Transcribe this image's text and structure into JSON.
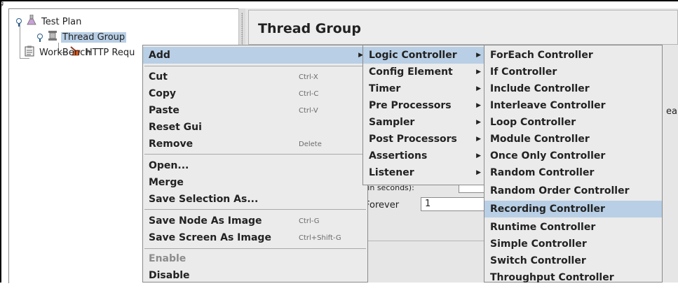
{
  "window": {
    "corner_mark": "g"
  },
  "tree": {
    "items": [
      {
        "label": "Test Plan",
        "icon": "flask-icon"
      },
      {
        "label": "Thread Group",
        "icon": "spool-icon"
      },
      {
        "label": "HTTP Requ",
        "icon": "broom-icon"
      },
      {
        "label": "WorkBench",
        "icon": "clipboard-icon"
      }
    ]
  },
  "panel": {
    "title": "Thread Group",
    "fragment_right": "ea",
    "seconds_fragment": "(in seconds):",
    "delay_value": "1",
    "loop_label": "Forever",
    "loop_value": "1"
  },
  "context_menu": {
    "items": [
      {
        "label": "Add",
        "shortcut": "",
        "submenu": true
      },
      {
        "label": "Cut",
        "shortcut": "Ctrl-X"
      },
      {
        "label": "Copy",
        "shortcut": "Ctrl-C"
      },
      {
        "label": "Paste",
        "shortcut": "Ctrl-V"
      },
      {
        "label": "Reset Gui",
        "shortcut": ""
      },
      {
        "label": "Remove",
        "shortcut": "Delete"
      },
      {
        "label": "Open...",
        "shortcut": ""
      },
      {
        "label": "Merge",
        "shortcut": ""
      },
      {
        "label": "Save Selection As...",
        "shortcut": ""
      },
      {
        "label": "Save Node As Image",
        "shortcut": "Ctrl-G"
      },
      {
        "label": "Save Screen As Image",
        "shortcut": "Ctrl+Shift-G"
      },
      {
        "label": "Enable",
        "shortcut": "",
        "disabled": true
      },
      {
        "label": "Disable",
        "shortcut": ""
      }
    ]
  },
  "add_menu": {
    "items": [
      {
        "label": "Logic Controller"
      },
      {
        "label": "Config Element"
      },
      {
        "label": "Timer"
      },
      {
        "label": "Pre Processors"
      },
      {
        "label": "Sampler"
      },
      {
        "label": "Post Processors"
      },
      {
        "label": "Assertions"
      },
      {
        "label": "Listener"
      }
    ]
  },
  "logic_menu": {
    "items": [
      {
        "label": "ForEach Controller"
      },
      {
        "label": "If Controller"
      },
      {
        "label": "Include Controller"
      },
      {
        "label": "Interleave Controller"
      },
      {
        "label": "Loop Controller"
      },
      {
        "label": "Module Controller"
      },
      {
        "label": "Once Only Controller"
      },
      {
        "label": "Random Controller"
      },
      {
        "label": "Random Order Controller"
      },
      {
        "label": "Recording Controller"
      },
      {
        "label": "Runtime Controller"
      },
      {
        "label": "Simple Controller"
      },
      {
        "label": "Switch Controller"
      },
      {
        "label": "Throughput Controller"
      }
    ]
  },
  "colors": {
    "highlight": "#b8cfe5",
    "menu_bg": "#ebebeb"
  }
}
